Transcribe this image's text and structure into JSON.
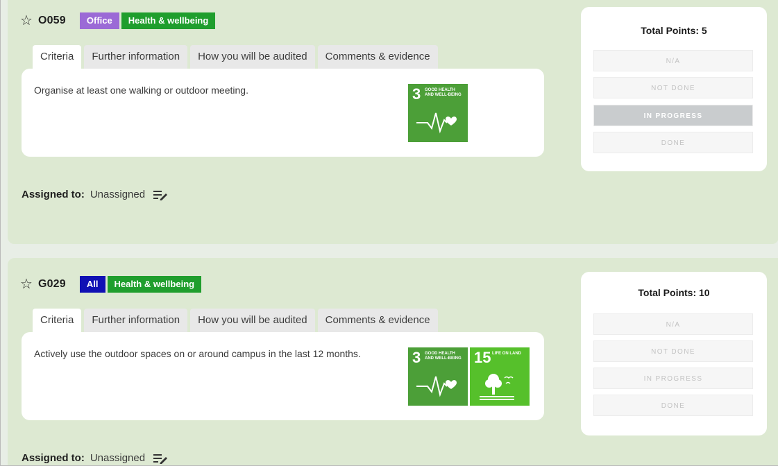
{
  "tasks": [
    {
      "code": "O059",
      "tags": [
        {
          "label": "Office",
          "color": "#9b6ad6"
        },
        {
          "label": "Health & wellbeing",
          "color": "#1f9e2d"
        }
      ],
      "tabs": [
        "Criteria",
        "Further information",
        "How you will be audited",
        "Comments & evidence"
      ],
      "active_tab": "Criteria",
      "criteria": "Organise at least one walking or outdoor meeting.",
      "sdgs": [
        {
          "number": "3",
          "label": "GOOD HEALTH AND WELL-BEING",
          "color": "#4c9f38",
          "icon": "heartbeat-icon"
        }
      ],
      "points": {
        "title": "Total Points: 5",
        "options": [
          "N/A",
          "NOT DONE",
          "IN PROGRESS",
          "DONE"
        ],
        "selected": "IN PROGRESS"
      },
      "assigned_label": "Assigned to:",
      "assigned_value": "Unassigned"
    },
    {
      "code": "G029",
      "tags": [
        {
          "label": "All",
          "color": "#1010b4"
        },
        {
          "label": "Health & wellbeing",
          "color": "#1f9e2d"
        }
      ],
      "tabs": [
        "Criteria",
        "Further information",
        "How you will be audited",
        "Comments & evidence"
      ],
      "active_tab": "Criteria",
      "criteria": "Actively use the outdoor spaces on or around campus in the last 12 months.",
      "sdgs": [
        {
          "number": "3",
          "label": "GOOD HEALTH AND WELL-BEING",
          "color": "#4c9f38",
          "icon": "heartbeat-icon"
        },
        {
          "number": "15",
          "label": "LIFE ON LAND",
          "color": "#56c02b",
          "icon": "tree-icon"
        }
      ],
      "points": {
        "title": "Total Points: 10",
        "options": [
          "N/A",
          "NOT DONE",
          "IN PROGRESS",
          "DONE"
        ],
        "selected": ""
      },
      "assigned_label": "Assigned to:",
      "assigned_value": "Unassigned"
    }
  ],
  "icons": {
    "star": "star-outline-icon",
    "edit": "edit-list-icon"
  }
}
